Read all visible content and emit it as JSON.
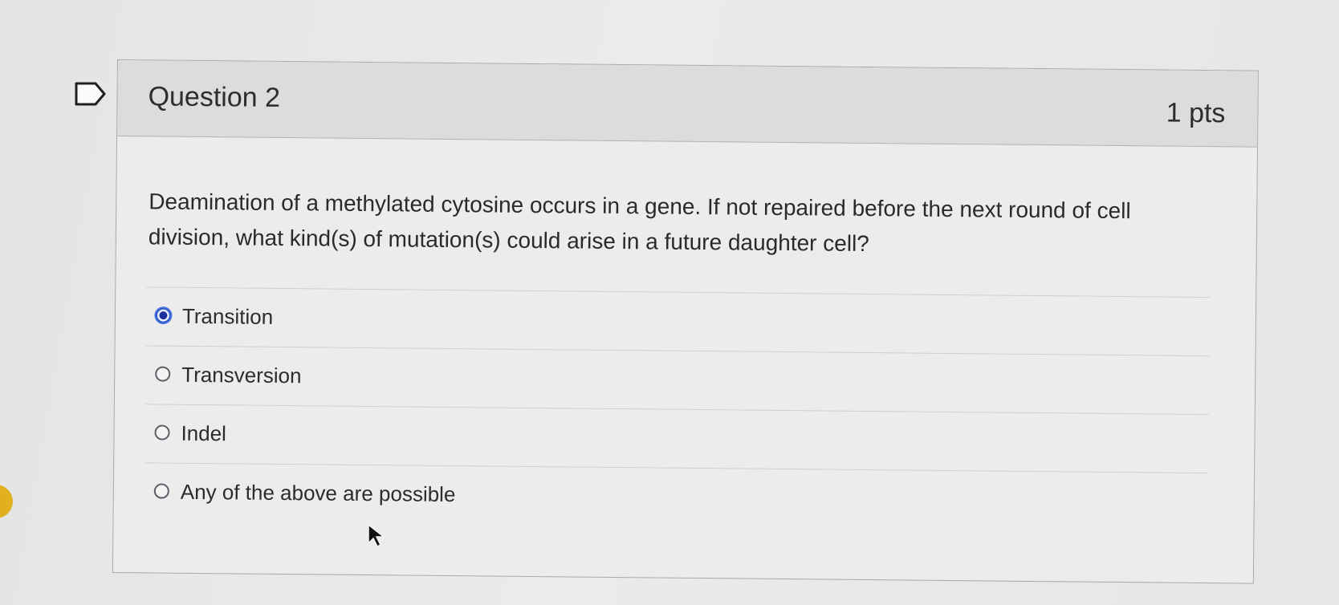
{
  "question": {
    "title": "Question 2",
    "points": "1 pts",
    "text": "Deamination of a methylated cytosine occurs in a gene. If not repaired before the next round of cell division, what kind(s) of mutation(s) could arise in a future daughter cell?"
  },
  "answers": [
    {
      "label": "Transition",
      "selected": true
    },
    {
      "label": "Transversion",
      "selected": false
    },
    {
      "label": "Indel",
      "selected": false
    },
    {
      "label": "Any of the above are possible",
      "selected": false
    }
  ],
  "icons": {
    "flag": "flag-question-icon",
    "pointer": "mouse-pointer-icon"
  },
  "colors": {
    "selected_radio": "#1d2f98",
    "side_tab": "#e0b01f"
  }
}
